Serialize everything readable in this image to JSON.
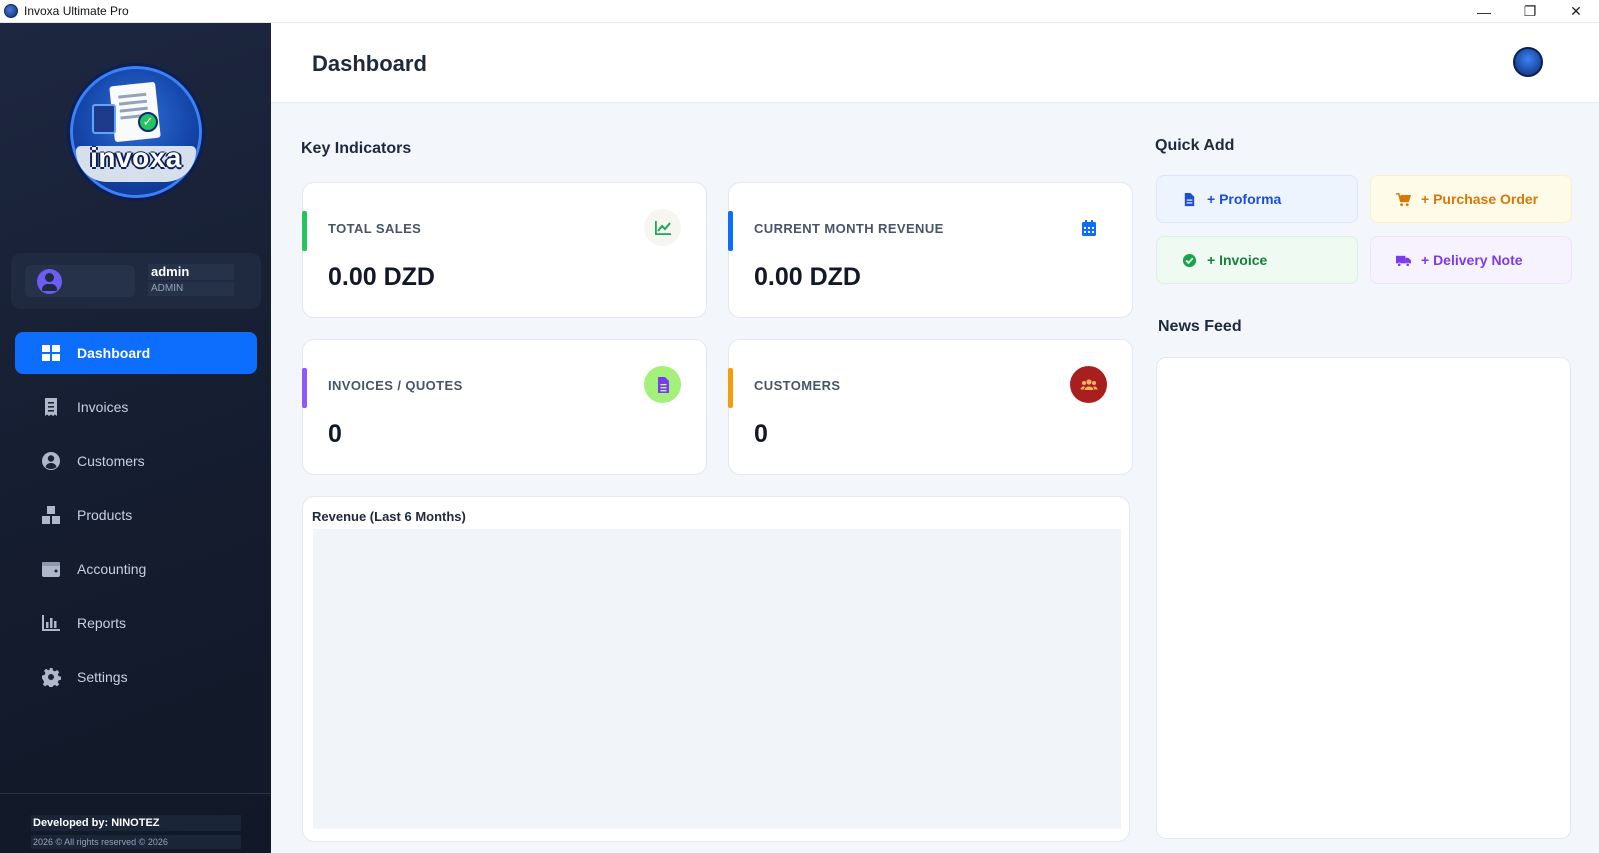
{
  "window": {
    "title": "Invoxa Ultimate Pro",
    "minimize": "—",
    "maximize": "❐",
    "close": "✕"
  },
  "brand": {
    "logo_text": "invoxa"
  },
  "user": {
    "name": "admin",
    "role": "ADMIN"
  },
  "nav": [
    {
      "label": "Dashboard",
      "icon": "dashboard-icon",
      "active": true
    },
    {
      "label": "Invoices",
      "icon": "receipt-icon"
    },
    {
      "label": "Customers",
      "icon": "user-circle-icon"
    },
    {
      "label": "Products",
      "icon": "boxes-icon"
    },
    {
      "label": "Accounting",
      "icon": "wallet-icon"
    },
    {
      "label": "Reports",
      "icon": "bar-chart-icon"
    },
    {
      "label": "Settings",
      "icon": "gear-icon"
    }
  ],
  "footer": {
    "developed_by": "Developed by: NINOTEZ",
    "copyright": "2026 © All rights reserved © 2026"
  },
  "header": {
    "title": "Dashboard"
  },
  "key_indicators": {
    "title": "Key Indicators",
    "cards": [
      {
        "label": "TOTAL SALES",
        "value": "0.00 DZD",
        "accent": "#22c55e",
        "icon": "trend-chart-icon"
      },
      {
        "label": "CURRENT MONTH REVENUE",
        "value": "0.00 DZD",
        "accent": "#0d6efd",
        "icon": "calendar-icon"
      },
      {
        "label": "INVOICES / QUOTES",
        "value": "0",
        "accent": "#8b5cf6",
        "icon": "document-icon"
      },
      {
        "label": "CUSTOMERS",
        "value": "0",
        "accent": "#f59e0b",
        "icon": "users-icon"
      }
    ]
  },
  "chart": {
    "title": "Revenue (Last 6 Months)"
  },
  "quick_add": {
    "title": "Quick Add",
    "items": [
      {
        "label": "+ Proforma",
        "icon": "file-icon",
        "color": "#1d4ed8",
        "bg": "#eef4fe"
      },
      {
        "label": "+ Purchase Order",
        "icon": "cart-icon",
        "color": "#d97706",
        "bg": "#fefbe9"
      },
      {
        "label": "+ Invoice",
        "icon": "check-circle-icon",
        "color": "#15803d",
        "bg": "#effaf2"
      },
      {
        "label": "+ Delivery Note",
        "icon": "truck-icon",
        "color": "#7c3aed",
        "bg": "#f6f3fe"
      }
    ]
  },
  "news_feed": {
    "title": "News Feed"
  }
}
